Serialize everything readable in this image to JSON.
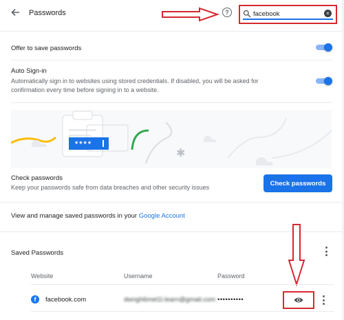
{
  "header": {
    "title": "Passwords",
    "back_icon": "arrow-left-icon",
    "help_icon": "help-circle-icon"
  },
  "search": {
    "value": "facebook",
    "icon": "search-icon",
    "clear_icon": "clear-icon"
  },
  "settings": {
    "offer_save": {
      "label": "Offer to save passwords",
      "enabled": true
    },
    "auto_signin": {
      "label": "Auto Sign-in",
      "description": "Automatically sign in to websites using stored credentials. If disabled, you will be asked for confirmation every time before signing in to a website.",
      "enabled": true
    }
  },
  "check": {
    "illustration_text": "****",
    "title": "Check passwords",
    "description": "Keep your passwords safe from data breaches and other security issues",
    "button_label": "Check passwords"
  },
  "manage": {
    "text": "View and manage saved passwords in your ",
    "link": "Google Account"
  },
  "saved": {
    "title": "Saved Passwords",
    "columns": [
      "Website",
      "Username",
      "Password"
    ],
    "rows": [
      {
        "website": "facebook.com",
        "username": "dwngh6met1l.learn@gmail.com",
        "password": "••••••••••"
      }
    ]
  },
  "colors": {
    "accent": "#1a73e8",
    "annotation_red": "#d5282f"
  }
}
